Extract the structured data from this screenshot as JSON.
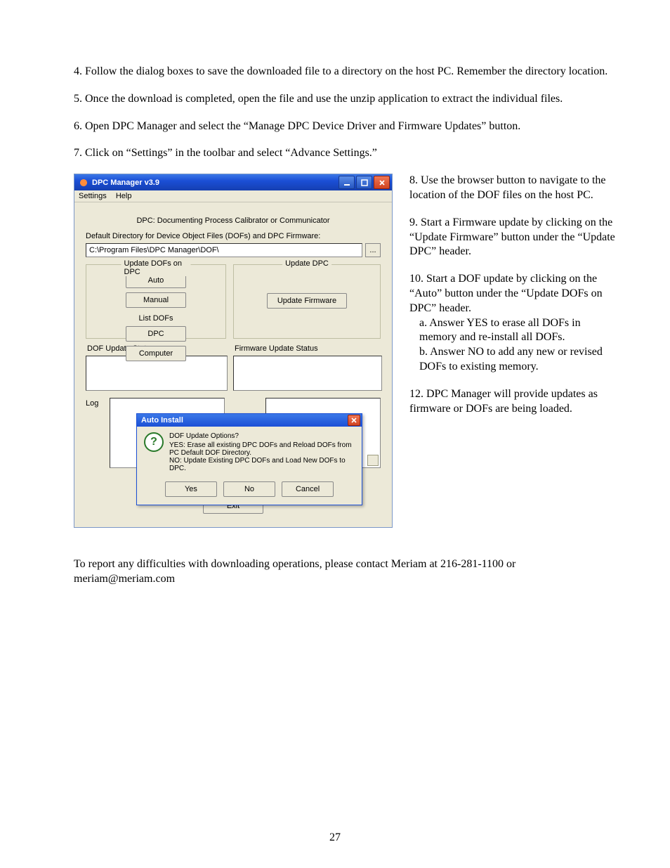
{
  "steps": {
    "s4": "4. Follow the dialog boxes to save the downloaded file to a directory on the host PC. Remember the directory location.",
    "s5": "5. Once the download is completed, open the file and use the unzip application to extract the individual files.",
    "s6": "6. Open DPC Manager and select the “Manage DPC Device Driver and Firmware Updates” button.",
    "s7": "7. Click on “Settings” in the toolbar and select “Advance Settings.”",
    "s8": "8. Use the browser button to navigate to the location of the DOF files on the host PC.",
    "s9": "9. Start a Firmware update by clicking on the “Update Firmware” button under the “Update DPC” header.",
    "s10": "10. Start a DOF update by clicking on the “Auto” button under the “Update DOFs on DPC” header.",
    "s10a": "a. Answer YES to erase all DOFs in memory and re-install all DOFs.",
    "s10b": "b. Answer NO to add any new or revised DOFs to existing memory.",
    "s12": "12. DPC Manager will provide updates as firmware or DOFs are being loaded.",
    "footer": "To report any difficulties with downloading operations, please contact Meriam at 216-281-1100 or meriam@meriam.com"
  },
  "app": {
    "title": "DPC Manager v3.9",
    "menu": {
      "settings": "Settings",
      "help": "Help"
    },
    "header": "DPC: Documenting Process Calibrator or Communicator",
    "dir_label": "Default Directory for Device Object Files (DOFs) and DPC Firmware:",
    "dir_value": "C:\\Program Files\\DPC Manager\\DOF\\",
    "browse": "...",
    "dofs_legend": "Update DOFs on DPC",
    "dpc_legend": "Update DPC",
    "auto_btn": "Auto",
    "manual_btn": "Manual",
    "list_dofs": "List DOFs",
    "dpc_btn": "DPC",
    "computer_btn": "Computer",
    "update_fw": "Update Firmware",
    "dof_status": "DOF Update Status",
    "fw_status": "Firmware Update Status",
    "log": "Log",
    "exit": "Exit"
  },
  "dialog": {
    "title": "Auto Install",
    "line1": "DOF Update Options?",
    "line2": "YES: Erase all existing DPC DOFs and Reload DOFs from PC Default DOF Directory.",
    "line3": "NO: Update Existing DPC DOFs and Load New DOFs to DPC.",
    "yes": "Yes",
    "no": "No",
    "cancel": "Cancel"
  },
  "page_number": "27"
}
